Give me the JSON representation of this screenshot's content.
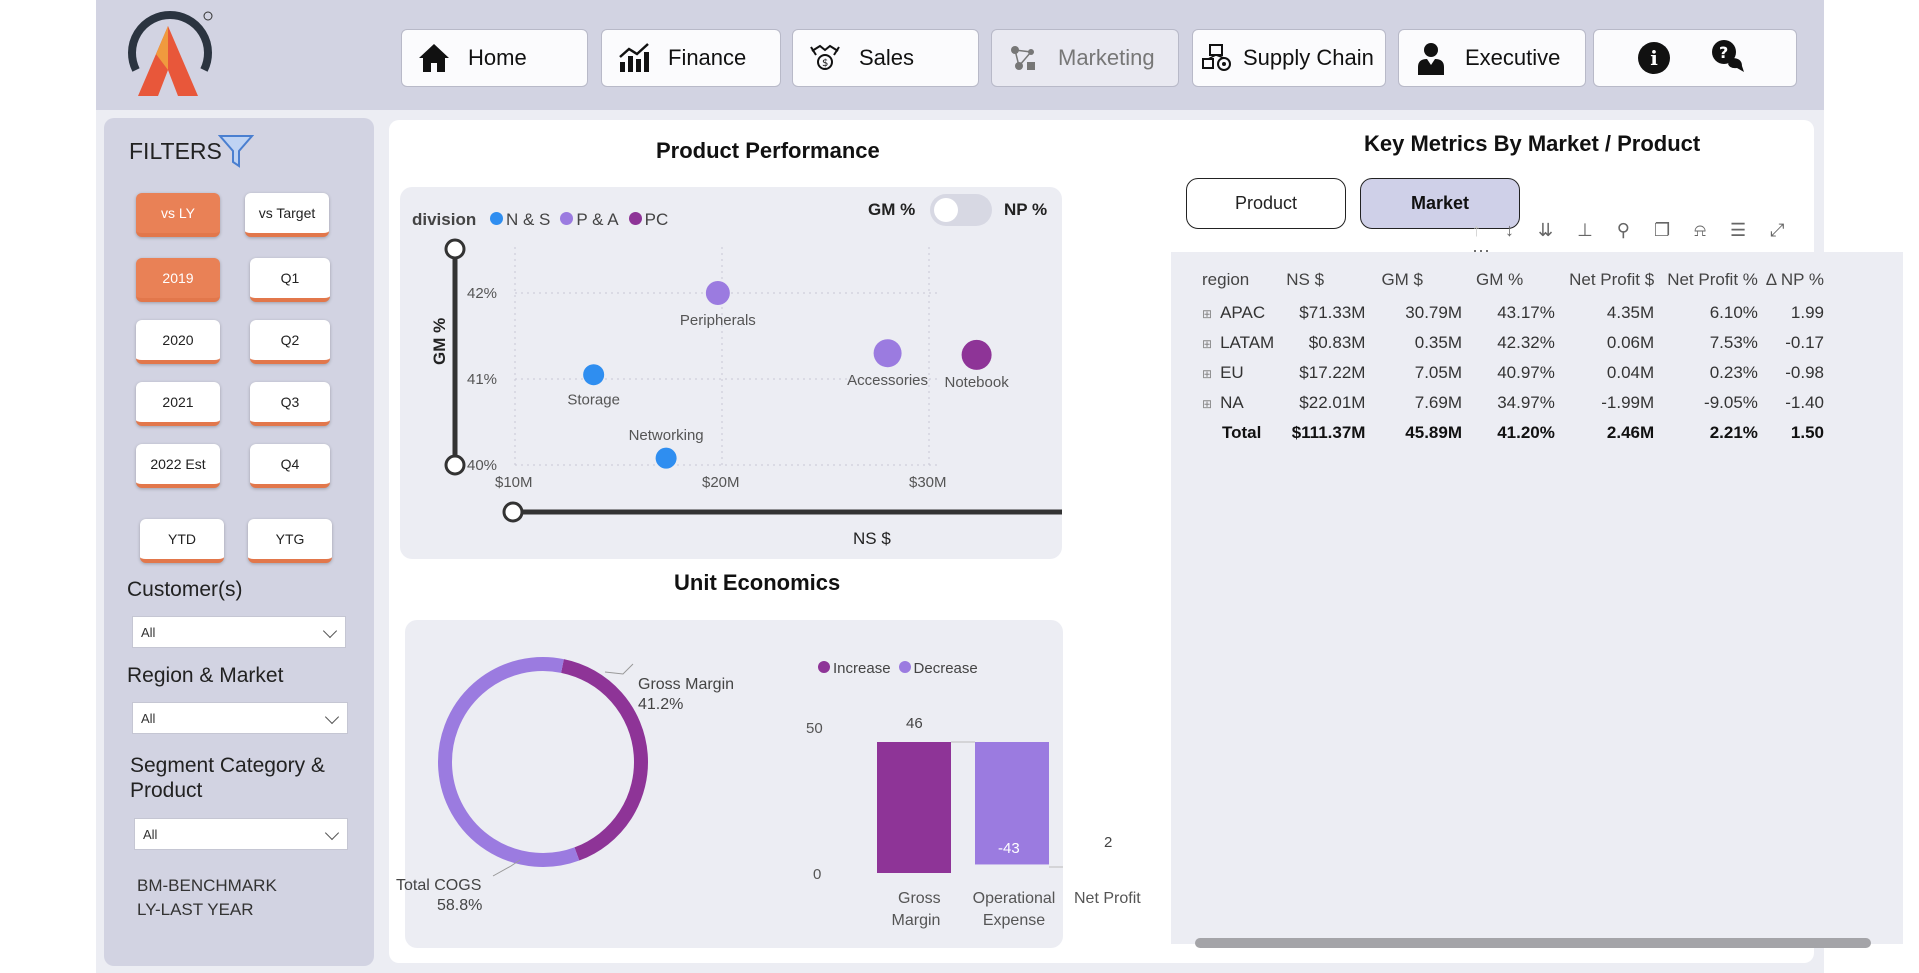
{
  "nav": {
    "home": "Home",
    "finance": "Finance",
    "sales": "Sales",
    "marketing": "Marketing",
    "supply_chain": "Supply Chain",
    "executive": "Executive"
  },
  "filters": {
    "title": "FILTERS",
    "vs_ly": "vs LY",
    "vs_target": "vs Target",
    "years": [
      "2019",
      "2020",
      "2021",
      "2022 Est"
    ],
    "quarters": [
      "Q1",
      "Q2",
      "Q3",
      "Q4"
    ],
    "ytd": "YTD",
    "ytg": "YTG",
    "customer_label": "Customer(s)",
    "customer_value": "All",
    "region_label": "Region & Market",
    "region_value": "All",
    "segment_label_1": "Segment Category &",
    "segment_label_2": "Product",
    "segment_value": "All",
    "note_1": "BM-BENCHMARK",
    "note_2": "LY-LAST YEAR"
  },
  "product_performance": {
    "title": "Product Performance",
    "legend_title": "division",
    "legend": [
      {
        "label": "N & S",
        "color": "#2f8ef0"
      },
      {
        "label": "P & A",
        "color": "#9b7be0"
      },
      {
        "label": "PC",
        "color": "#8e3497"
      }
    ],
    "toggle_left": "GM %",
    "toggle_right": "NP %",
    "y_label": "GM %",
    "x_label": "NS $",
    "y_ticks": [
      "42%",
      "41%",
      "40%"
    ],
    "x_ticks": [
      "$10M",
      "$20M",
      "$30M"
    ]
  },
  "chart_data": [
    {
      "type": "scatter",
      "title": "Product Performance",
      "xlabel": "NS $",
      "ylabel": "GM %",
      "xlim": [
        10,
        35
      ],
      "ylim": [
        40,
        42.5
      ],
      "x_ticks": [
        "$10M",
        "$20M",
        "$30M"
      ],
      "y_ticks": [
        "42%",
        "41%",
        "40%"
      ],
      "grid": true,
      "legend_position": "top-left",
      "points": [
        {
          "label": "Peripherals",
          "x": 19.8,
          "y": 42.0,
          "division": "P & A",
          "color": "#9b7be0"
        },
        {
          "label": "Storage",
          "x": 13.8,
          "y": 41.05,
          "division": "N & S",
          "color": "#2f8ef0"
        },
        {
          "label": "Accessories",
          "x": 28.0,
          "y": 41.3,
          "division": "P & A",
          "color": "#9b7be0"
        },
        {
          "label": "Notebook",
          "x": 32.3,
          "y": 41.28,
          "division": "PC",
          "color": "#8e3497"
        },
        {
          "label": "Networking",
          "x": 17.3,
          "y": 40.08,
          "division": "N & S",
          "color": "#2f8ef0"
        }
      ]
    },
    {
      "type": "pie",
      "title": "Unit Economics",
      "slices": [
        {
          "label": "Gross Margin",
          "value": 41.2,
          "text": "41.2%",
          "color": "#8e3497"
        },
        {
          "label": "Total COGS",
          "value": 58.8,
          "text": "58.8%",
          "color": "#9b7be0"
        }
      ]
    },
    {
      "type": "bar",
      "subtype": "waterfall",
      "categories": [
        "Gross Margin",
        "Operational Expense",
        "Net Profit"
      ],
      "values": [
        46,
        -43,
        2
      ],
      "labels": [
        "46",
        "-43",
        "2"
      ],
      "legend": [
        {
          "label": "Increase",
          "color": "#8e3497"
        },
        {
          "label": "Decrease",
          "color": "#9b7be0"
        }
      ],
      "y_ticks": [
        "50",
        "0"
      ],
      "ylim": [
        0,
        50
      ]
    }
  ],
  "unit_economics": {
    "title": "Unit Economics",
    "donut_gm_label": "Gross Margin",
    "donut_gm_value": "41.2%",
    "donut_cogs_label": "Total COGS",
    "donut_cogs_value": "58.8%",
    "legend_increase": "Increase",
    "legend_decrease": "Decrease",
    "y_tick_50": "50",
    "y_tick_0": "0",
    "cat_gm_1": "Gross",
    "cat_gm_2": "Margin",
    "cat_opex_1": "Operational",
    "cat_opex_2": "Expense",
    "cat_np": "Net Profit",
    "val_gm": "46",
    "val_opex": "-43",
    "val_np": "2"
  },
  "key_metrics": {
    "title": "Key Metrics By Market / Product",
    "btn_product": "Product",
    "btn_market": "Market",
    "columns": [
      "region",
      "NS $",
      "GM $",
      "GM %",
      "Net Profit $",
      "Net Profit %",
      "Δ NP %"
    ],
    "rows": [
      [
        "APAC",
        "$71.33M",
        "30.79M",
        "43.17%",
        "4.35M",
        "6.10%",
        "1.99"
      ],
      [
        "LATAM",
        "$0.83M",
        "0.35M",
        "42.32%",
        "0.06M",
        "7.53%",
        "-0.17"
      ],
      [
        "EU",
        "$17.22M",
        "7.05M",
        "40.97%",
        "0.04M",
        "0.23%",
        "-0.98"
      ],
      [
        "NA",
        "$22.01M",
        "7.69M",
        "34.97%",
        "-1.99M",
        "-9.05%",
        "-1.40"
      ]
    ],
    "total": [
      "Total",
      "$111.37M",
      "45.89M",
      "41.20%",
      "2.46M",
      "2.21%",
      "1.50"
    ]
  }
}
